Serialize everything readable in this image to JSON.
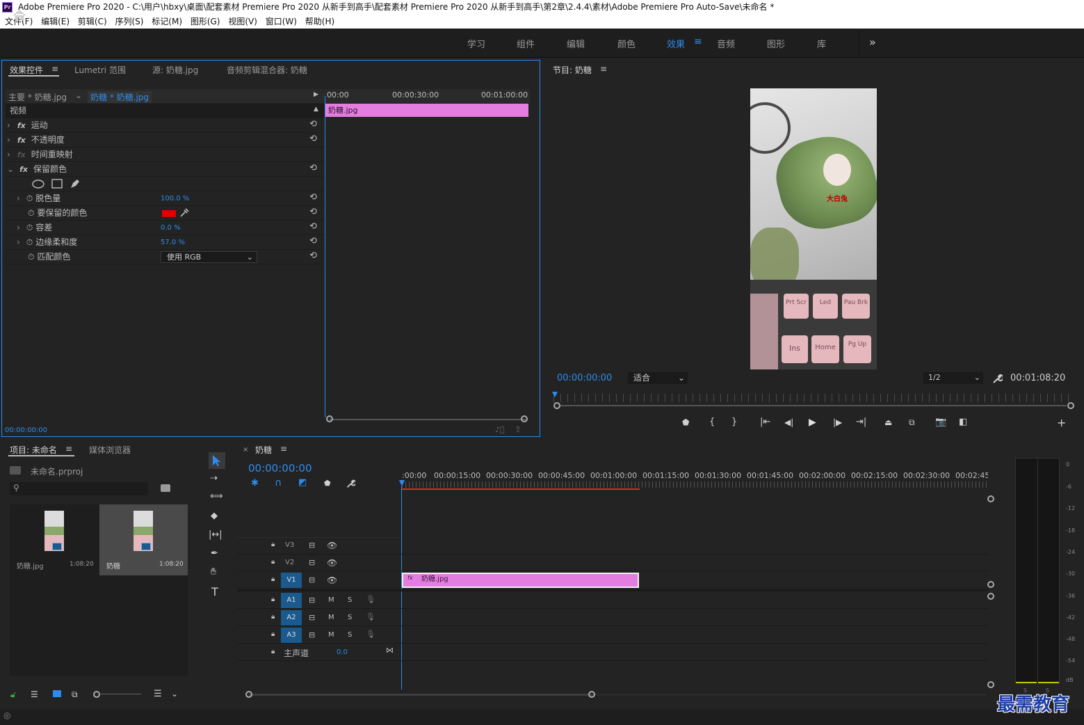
{
  "window": {
    "title": "Adobe Premiere Pro 2020 - C:\\用户\\hbxy\\桌面\\配套素材 Premiere Pro 2020 从新手到高手\\配套素材 Premiere Pro 2020 从新手到高手\\第2章\\2.4.4\\素材\\Adobe Premiere Pro Auto-Save\\未命名 *",
    "logo": "Pr"
  },
  "menu": [
    "文件(F)",
    "编辑(E)",
    "剪辑(C)",
    "序列(S)",
    "标记(M)",
    "图形(G)",
    "视图(V)",
    "窗口(W)",
    "帮助(H)"
  ],
  "workspaces": [
    "学习",
    "组件",
    "编辑",
    "颜色",
    "效果",
    "音频",
    "图形",
    "库"
  ],
  "workspace_active": "效果",
  "workspace_more": "»",
  "effect_controls": {
    "tabs": [
      "效果控件",
      "Lumetri 范围",
      "源: 奶糖.jpg",
      "音频剪辑混合器: 奶糖"
    ],
    "master_label": "主要 * 奶糖.jpg",
    "clip_label": "奶糖 * 奶糖.jpg",
    "ruler": [
      "00:00",
      "00:00:30:00",
      "00:01:00:00"
    ],
    "clip_bar": "奶糖.jpg",
    "section": "视频",
    "effects": [
      "运动",
      "不透明度",
      "时间重映射",
      "保留颜色"
    ],
    "params": [
      {
        "name": "脱色量",
        "value": "100.0 %"
      },
      {
        "name": "要保留的颜色",
        "value": ""
      },
      {
        "name": "容差",
        "value": "0.0 %"
      },
      {
        "name": "边缘柔和度",
        "value": "57.0 %"
      },
      {
        "name": "匹配颜色",
        "value": "使用 RGB"
      }
    ],
    "keep_color": "#e00000",
    "timecode": "00:00:00:00"
  },
  "program": {
    "tab": "节目: 奶糖",
    "timecode": "00:00:00:00",
    "fit": "适合",
    "resolution": "1/2",
    "duration": "00:01:08:20",
    "keys": [
      "Prt Scr",
      "Led",
      "Pau Brk",
      "Ins",
      "Home",
      "Pg Up"
    ],
    "candy_text": "大白兔"
  },
  "project": {
    "tabs": [
      "项目: 未命名",
      "媒体浏览器"
    ],
    "file": "未命名.prproj",
    "items": [
      {
        "name": "奶糖.jpg",
        "duration": "1:08:20"
      },
      {
        "name": "奶糖",
        "duration": "1:08:20"
      }
    ]
  },
  "timeline": {
    "tab": "奶糖",
    "timecode": "00:00:00:00",
    "ruler": [
      ":00:00",
      "00:00:15:00",
      "00:00:30:00",
      "00:00:45:00",
      "00:01:00:00",
      "00:01:15:00",
      "00:01:30:00",
      "00:01:45:00",
      "00:02:00:00",
      "00:02:15:00",
      "00:02:30:00",
      "00:02:45:"
    ],
    "video_tracks": [
      "V3",
      "V2",
      "V1"
    ],
    "audio_tracks": [
      "A1",
      "A2",
      "A3"
    ],
    "mute": "M",
    "solo": "S",
    "master": "主声道",
    "master_value": "0.0",
    "clip": "奶糖.jpg",
    "clip_color": "#e37ee0"
  },
  "meter_scale": [
    "0",
    "-6",
    "-12",
    "-18",
    "-24",
    "-30",
    "-36",
    "-42",
    "-48",
    "-54",
    "dB"
  ],
  "meter_channels": [
    "S",
    "S"
  ],
  "watermark": "最需教育"
}
